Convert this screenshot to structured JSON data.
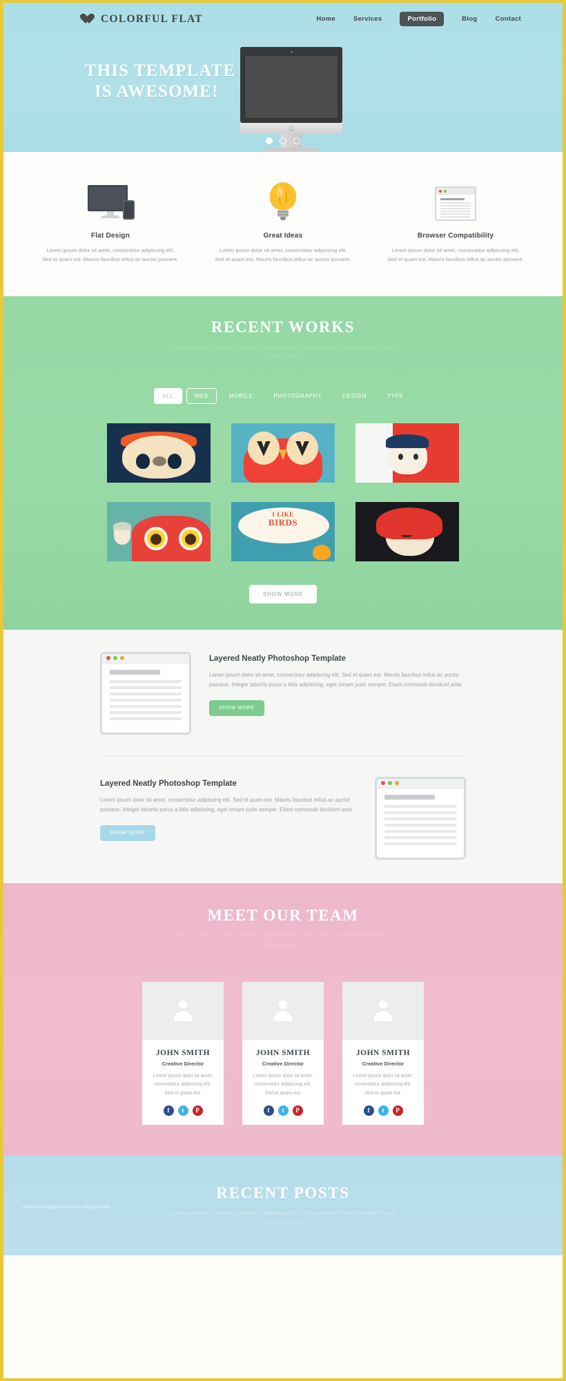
{
  "header": {
    "brand": "COLORFUL FLAT",
    "nav": [
      {
        "label": "Home",
        "active": false
      },
      {
        "label": "Services",
        "active": false
      },
      {
        "label": "Portfolio",
        "active": true
      },
      {
        "label": "Blog",
        "active": false
      },
      {
        "label": "Contact",
        "active": false
      }
    ]
  },
  "hero": {
    "title_line1": "THIS TEMPLATE",
    "title_line2": "IS AWESOME!",
    "slider_dots": 3,
    "active_dot": 1
  },
  "features": [
    {
      "icon": "monitor-phone-icon",
      "title": "Flat Design",
      "text": "Lorem ipsum dolor sit amet, consectetur adipiscing elit. Sed et quam est. Mauris faucibus tellus ac auctor posuere."
    },
    {
      "icon": "lightbulb-icon",
      "title": "Great Ideas",
      "text": "Lorem ipsum dolor sit amet, consectetur adipiscing elit. Sed et quam est. Mauris faucibus tellus ac auctor posuere."
    },
    {
      "icon": "browser-window-icon",
      "title": "Browser Compatibility",
      "text": "Lorem ipsum dolor sit amet, consectetur adipiscing elit. Sed et quam est. Mauris faucibus tellus ac auctor posuere."
    }
  ],
  "works": {
    "title": "RECENT WORKS",
    "subtitle": "Lorem ipsum dolor sit amet, consectetur adipiscing elit. Sed et quam est. Mauris faucibus tellus ac auctor posuere.",
    "filters": [
      {
        "label": "ALL",
        "state": "active"
      },
      {
        "label": "WEB",
        "state": "outline"
      },
      {
        "label": "MOBILE",
        "state": "plain"
      },
      {
        "label": "PHOTOGRAPHY",
        "state": "plain"
      },
      {
        "label": "DESIGN",
        "state": "plain"
      },
      {
        "label": "TYPE",
        "state": "plain"
      }
    ],
    "items": [
      {
        "name": "orange-haired-creature-illustration"
      },
      {
        "name": "red-owl-heart-eyes-illustration"
      },
      {
        "name": "blue-hair-girl-red-background-illustration"
      },
      {
        "name": "red-owl-pattern-illustration"
      },
      {
        "name": "i-like-birds-lettering-illustration"
      },
      {
        "name": "red-hair-winking-face-illustration"
      }
    ],
    "show_more": "SHOW MORE"
  },
  "content_blocks": [
    {
      "title": "Layered Neatly Photoshop Template",
      "text": "Lorem ipsum dolor sit amet, consectetur adipiscing elit. Sed et quam est. Mauris faucibus tellus ac auctor posuere. Integer lobortis purus a felis adipiscing, eget ornare justo semper. Etiam commodo tincidunt ante.",
      "button": "SHOW MORE",
      "button_color": "#7ecb8f",
      "image_position": "left"
    },
    {
      "title": "Layered Neatly Photoshop Template",
      "text": "Lorem ipsum dolor sit amet, consectetur adipiscing elit. Sed et quam est. Mauris faucibus tellus ac auctor posuere. Integer lobortis purus a felis adipiscing, eget ornare justo semper. Etiam commodo tincidunt ante.",
      "button": "SHOW MORE",
      "button_color": "#a8d8e8",
      "image_position": "right"
    }
  ],
  "team": {
    "title": "MEET OUR TEAM",
    "subtitle": "Lorem ipsum dolor sit amet, consectetur adipiscing elit. Sed et quam est. Mauris faucibus tellus ac auctor posuere.",
    "members": [
      {
        "name": "JOHN SMITH",
        "role": "Creative Director",
        "bio": "Lorem ipsum dolor sit amet, consectetur adipiscing elit. Sed et quam est.",
        "socials": [
          {
            "name": "facebook-icon",
            "glyph": "f",
            "color": "#2d4b8e"
          },
          {
            "name": "twitter-icon",
            "glyph": "t",
            "color": "#3fb3e3"
          },
          {
            "name": "pinterest-icon",
            "glyph": "P",
            "color": "#cb2027"
          }
        ]
      },
      {
        "name": "JOHN SMITH",
        "role": "Creative Director",
        "bio": "Lorem ipsum dolor sit amet, consectetur adipiscing elit. Sed et quam est.",
        "socials": [
          {
            "name": "facebook-icon",
            "glyph": "f",
            "color": "#2d4b8e"
          },
          {
            "name": "twitter-icon",
            "glyph": "t",
            "color": "#3fb3e3"
          },
          {
            "name": "pinterest-icon",
            "glyph": "P",
            "color": "#cb2027"
          }
        ]
      },
      {
        "name": "JOHN SMITH",
        "role": "Creative Director",
        "bio": "Lorem ipsum dolor sit amet, consectetur adipiscing elit. Sed et quam est.",
        "socials": [
          {
            "name": "facebook-icon",
            "glyph": "f",
            "color": "#2d4b8e"
          },
          {
            "name": "twitter-icon",
            "glyph": "t",
            "color": "#3fb3e3"
          },
          {
            "name": "pinterest-icon",
            "glyph": "P",
            "color": "#cb2027"
          }
        ]
      }
    ]
  },
  "posts": {
    "title": "RECENT POSTS",
    "subtitle": "Lorem ipsum dolor sit amet, consectetur adipiscing elit. Sed et quam est. Mauris faucibus tellus ac auctor posuere.",
    "watermark": "www.heritagechristiancollege.com"
  },
  "colors": {
    "page_border": "#e8c93a",
    "hero_bg": "#addfe8",
    "works_bg": "#95d8a4",
    "team_bg": "#edb8cb",
    "posts_bg": "#b6dcea"
  }
}
